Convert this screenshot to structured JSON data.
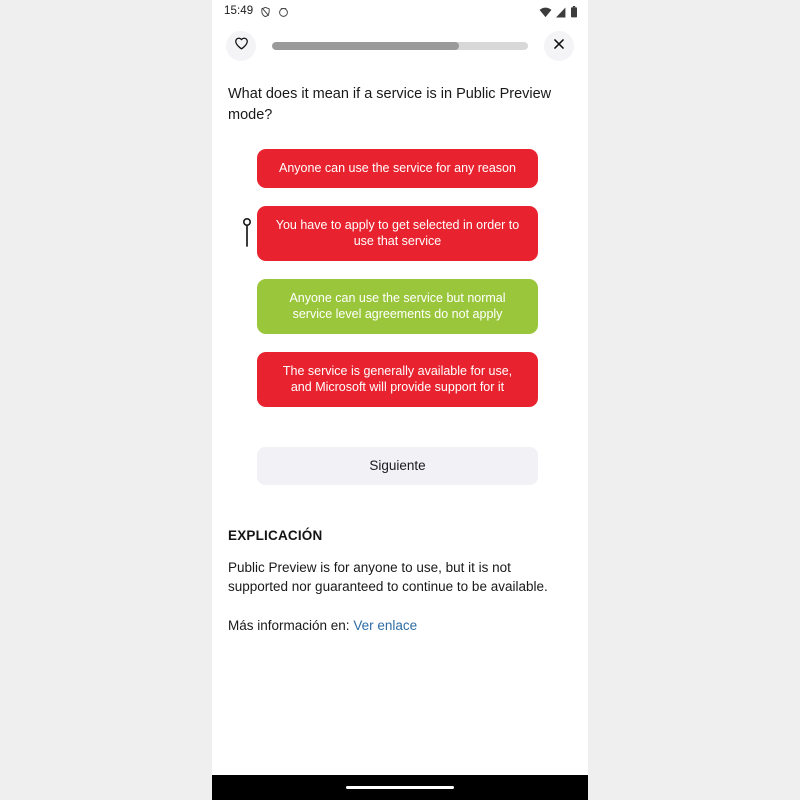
{
  "status_bar": {
    "time": "15:49",
    "left_icons": [
      "vpn-shield-icon",
      "dnd-circle-icon"
    ],
    "right_icons": [
      "wifi-icon",
      "cellular-signal-icon",
      "battery-icon"
    ]
  },
  "top_bar": {
    "favorite_icon": "heart-icon",
    "close_icon": "close-icon",
    "progress_percent": 73
  },
  "quiz": {
    "question": "What does it mean if a service is in Public Preview mode?",
    "pointer_icon": "pin-marker-icon",
    "answers": [
      {
        "label": "Anyone can use the service for any reason",
        "state": "red"
      },
      {
        "label": "You have to apply to get selected in order to use that service",
        "state": "red"
      },
      {
        "label": "Anyone can use the service but normal service level agreements do not apply",
        "state": "green"
      },
      {
        "label": "The service is generally available for use, and Microsoft will provide support for it",
        "state": "red"
      }
    ],
    "next_label": "Siguiente"
  },
  "explanation": {
    "heading": "EXPLICACIÓN",
    "body": "Public Preview is for anyone to use, but it is not supported nor guaranteed to continue to be available.",
    "more_info_prefix": "Más información en: ",
    "link_label": "Ver enlace"
  },
  "colors": {
    "incorrect": "#e8222e",
    "correct": "#9ac63b",
    "link": "#2f6ca5",
    "progress_fill": "#9a9a9a",
    "progress_track": "#d8d8d8"
  },
  "nav_bar": {
    "gesture_pill": "home-gesture-pill"
  }
}
